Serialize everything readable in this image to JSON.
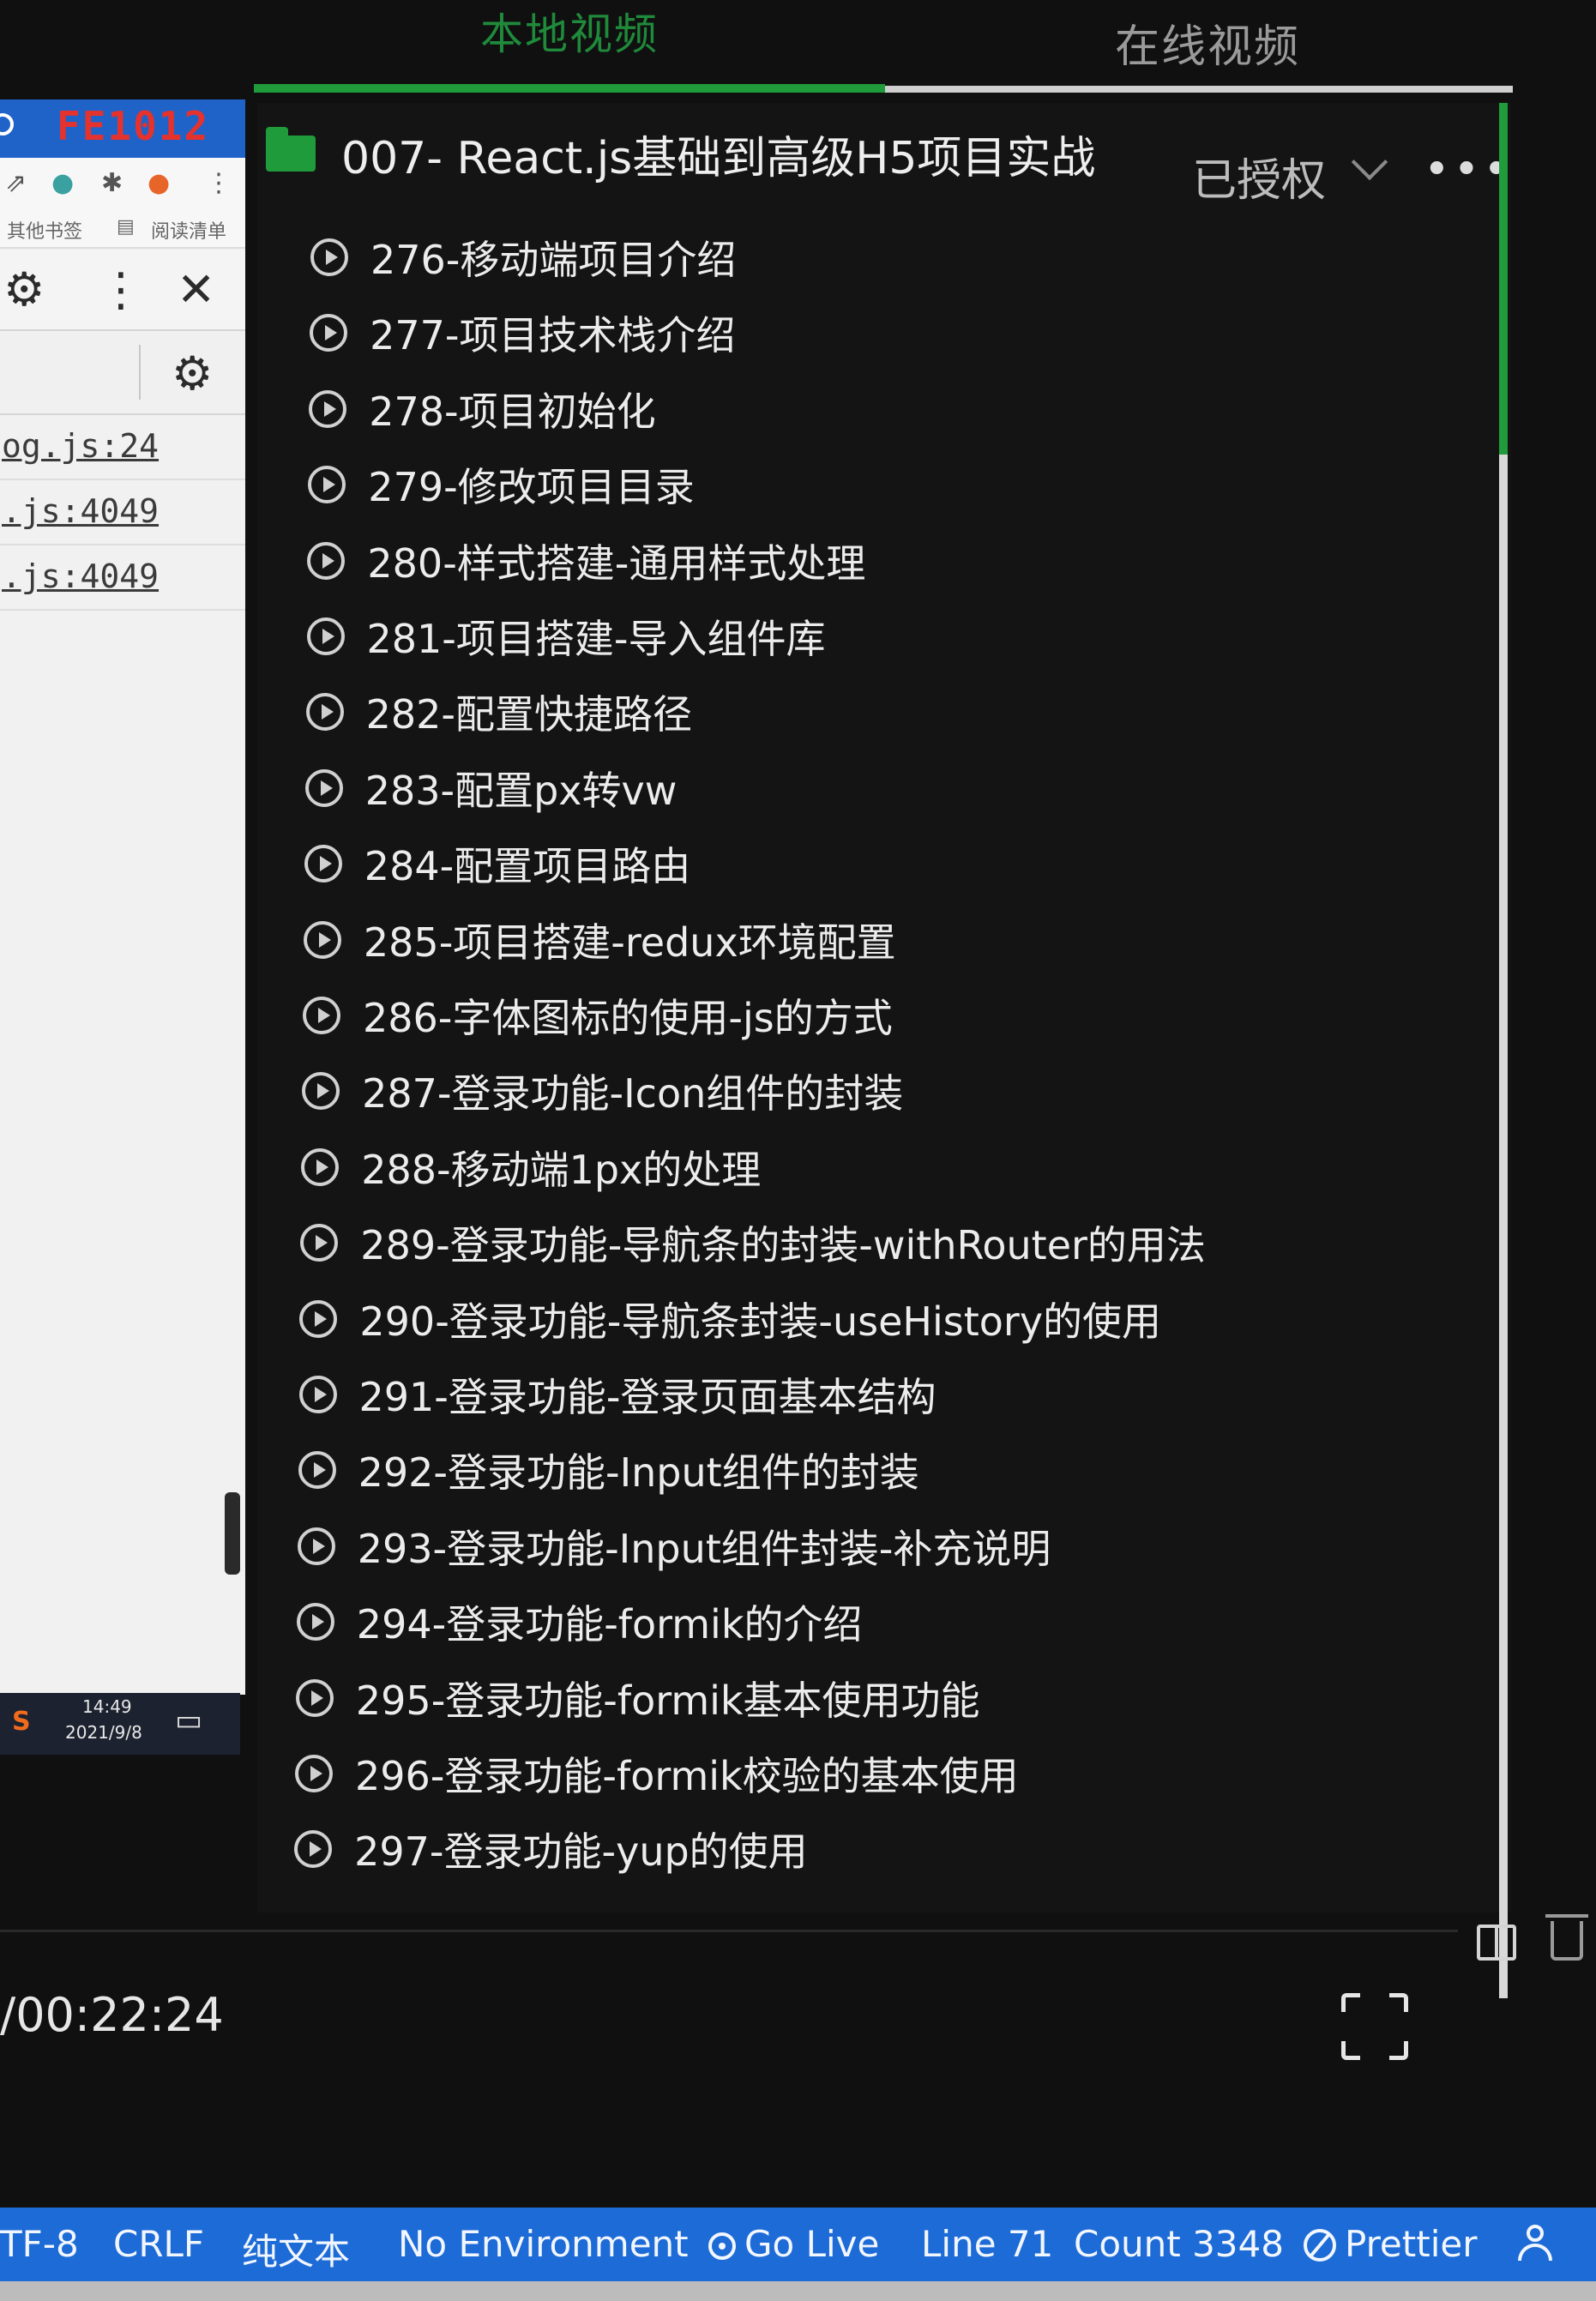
{
  "tabs": {
    "local": "本地视频",
    "online": "在线视频"
  },
  "browser": {
    "tab_title": "FE1012",
    "bookmarks_left": "其他书签",
    "bookmarks_right": "阅读清单",
    "source_links": [
      "og.js:24",
      ".js:4049",
      ".js:4049"
    ],
    "taskbar_time": "14:49",
    "taskbar_date": "2021/9/8"
  },
  "playlist": {
    "course_title": "007- React.js基础到高级H5项目实战",
    "auth_status": "已授权",
    "episodes": [
      "276-移动端项目介绍",
      "277-项目技术栈介绍",
      "278-项目初始化",
      "279-修改项目目录",
      "280-样式搭建-通用样式处理",
      "281-项目搭建-导入组件库",
      "282-配置快捷路径",
      "283-配置px转vw",
      "284-配置项目路由",
      "285-项目搭建-redux环境配置",
      "286-字体图标的使用-js的方式",
      "287-登录功能-Icon组件的封装",
      "288-移动端1px的处理",
      "289-登录功能-导航条的封装-withRouter的用法",
      "290-登录功能-导航条封装-useHistory的使用",
      "291-登录功能-登录页面基本结构",
      "292-登录功能-Input组件的封装",
      "293-登录功能-Input组件封装-补充说明",
      "294-登录功能-formik的介绍",
      "295-登录功能-formik基本使用功能",
      "296-登录功能-formik校验的基本使用",
      "297-登录功能-yup的使用"
    ]
  },
  "player": {
    "time": "/00:22:24"
  },
  "statusbar": {
    "encoding": "TF-8",
    "line_ending": "CRLF",
    "language": "纯文本",
    "environment": "No Environment",
    "go_live": "Go Live",
    "line": "Line 71",
    "count": "Count 3348",
    "prettier": "Prettier"
  },
  "colors": {
    "accent_green": "#1f9b3b",
    "status_blue": "#1d6bd6",
    "brand_red": "#e5322d"
  }
}
